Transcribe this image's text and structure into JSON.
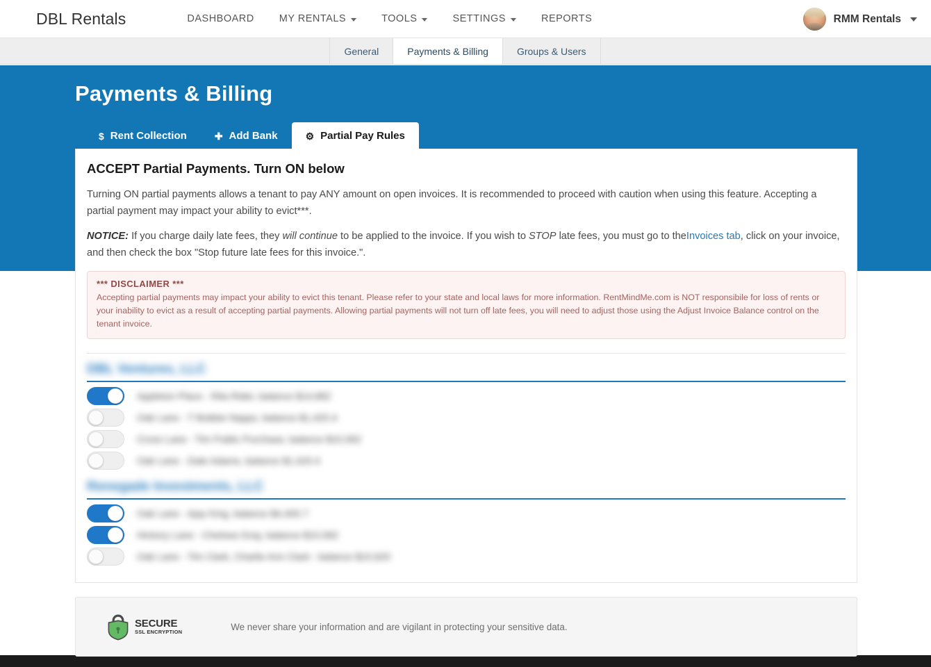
{
  "header": {
    "brand": "DBL Rentals",
    "nav": [
      {
        "label": "DASHBOARD",
        "caret": false
      },
      {
        "label": "MY RENTALS",
        "caret": true
      },
      {
        "label": "TOOLS",
        "caret": true
      },
      {
        "label": "SETTINGS",
        "caret": true
      },
      {
        "label": "REPORTS",
        "caret": false
      }
    ],
    "user": {
      "name": "RMM Rentals"
    }
  },
  "subnav": {
    "tabs": [
      {
        "label": "General",
        "active": false
      },
      {
        "label": "Payments & Billing",
        "active": true
      },
      {
        "label": "Groups & Users",
        "active": false
      }
    ]
  },
  "page": {
    "title": "Payments & Billing",
    "tabs": [
      {
        "label": "Rent Collection",
        "icon": "dollar-icon",
        "glyph": "$",
        "active": false
      },
      {
        "label": "Add Bank",
        "icon": "plus-icon",
        "glyph": "✚",
        "active": false
      },
      {
        "label": "Partial Pay Rules",
        "icon": "gear-icon",
        "glyph": "⚙",
        "active": true
      }
    ]
  },
  "content": {
    "heading": "ACCEPT Partial Payments. Turn ON below",
    "paragraph1": "Turning ON partial payments allows a tenant to pay ANY amount on open invoices. It is recommended to proceed with caution when using this feature. Accepting a partial payment may impact your ability to evict***.",
    "notice_label": "NOTICE:",
    "notice_part1": "If you charge daily late fees, they",
    "notice_italic": "will continue",
    "notice_part2": "to be applied to the invoice. If you wish to",
    "notice_italic2": "STOP",
    "notice_part3": "late fees, you must go to the",
    "notice_link": "Invoices tab",
    "notice_part4": ", click on your invoice, and then check the box \"Stop future late fees for this invoice.\".",
    "disclaimer": {
      "title": "*** DISCLAIMER ***",
      "body": "Accepting partial payments may impact your ability to evict this tenant. Please refer to your state and local laws for more information. RentMindMe.com is NOT responsibile for loss of rents or your inability to evict as a result of accepting partial payments. Allowing partial payments will not turn off late fees, you will need to adjust those using the Adjust Invoice Balance control on the tenant invoice."
    }
  },
  "groups": [
    {
      "name": "DBL Ventures, LLC",
      "rows": [
        {
          "label": "Appleton Place - Rita Rider, balance $14,882",
          "on": true
        },
        {
          "label": "Oak Lane - T Bobbie Napps, balance $1,420.4",
          "on": false
        },
        {
          "label": "Cross Lane - Tim Public Purchase, balance $10,562",
          "on": false
        },
        {
          "label": "Oak Lane - Dale Adams, balance $1,420.4",
          "on": false
        }
      ]
    },
    {
      "name": "Renegade Investments, LLC",
      "rows": [
        {
          "label": "Oak Lane - Ajay King, balance $4,400.7",
          "on": true
        },
        {
          "label": "Hickory Lane - Chelsea Gray, balance $10,582",
          "on": true
        },
        {
          "label": "Oak Lane - Tim Clark, Charlie Ann Clark - balance $10,620",
          "on": false
        }
      ]
    }
  ],
  "secure": {
    "seal_line1": "SECURE",
    "seal_line2": "SSL ENCRYPTION",
    "note": "We never share your information and are vigilant in protecting your sensitive data."
  },
  "colors": {
    "banner_blue": "#1376b5",
    "toggle_on": "#2078c8",
    "group_rule": "#2377b8",
    "link": "#2a7ab0",
    "disclaimer_bg": "#fdf3f2",
    "disclaimer_text": "#a4635f",
    "seal_green": "#63b964"
  }
}
